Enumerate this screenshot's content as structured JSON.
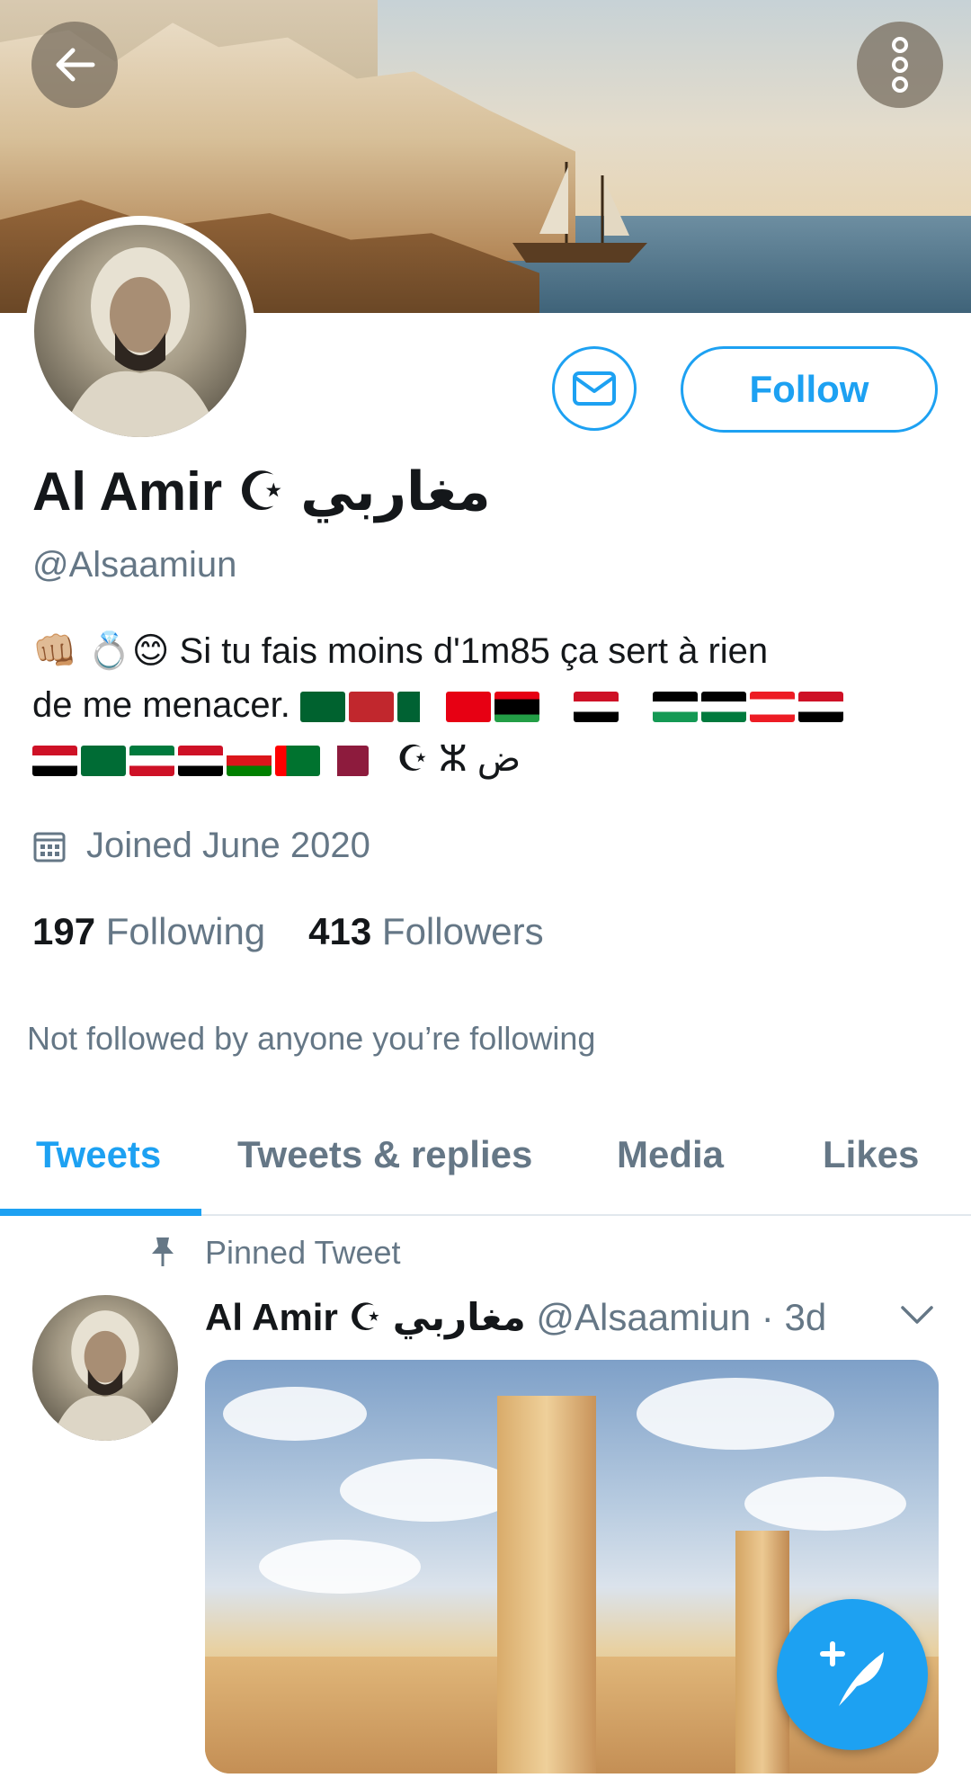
{
  "header": {
    "back_icon": "arrow-left-icon",
    "more_icon": "more-vertical-icon"
  },
  "profile": {
    "display_name": "Al Amir ☪ مغاربي",
    "handle": "@Alsaamiun",
    "follow_label": "Follow",
    "message_icon": "mail-icon",
    "bio_text_1": "Si tu fais moins d'1m85 ça sert à rien",
    "bio_text_2": "de me menacer.",
    "bio_emoji_prefix": "👊🏼 💍😊",
    "bio_symbols": "☪ ⵣ ض",
    "joined": "Joined June 2020",
    "following_count": "197",
    "following_label": "Following",
    "followers_count": "413",
    "followers_label": "Followers",
    "not_followed": "Not followed by anyone you’re following"
  },
  "tabs": [
    {
      "label": "Tweets",
      "active": true
    },
    {
      "label": "Tweets & replies",
      "active": false
    },
    {
      "label": "Media",
      "active": false
    },
    {
      "label": "Likes",
      "active": false
    }
  ],
  "pinned_tweet": {
    "pinned_label": "Pinned Tweet",
    "author_name": "Al Amir ☪ مغاربي",
    "author_handle_time": "@Alsaamiun · 3d"
  },
  "colors": {
    "accent": "#1da1f2",
    "secondary_text": "#657786"
  }
}
